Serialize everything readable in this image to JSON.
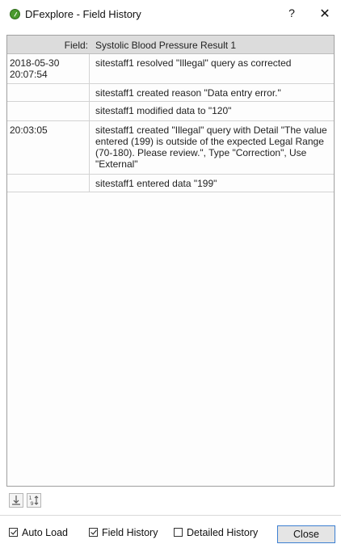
{
  "window": {
    "title": "DFexplore - Field History",
    "help_label": "?",
    "close_label": "✕",
    "app_icon": "dfexplore-logo-icon"
  },
  "history": {
    "field_label": "Field:",
    "field_value": "Systolic Blood Pressure Result 1",
    "rows": [
      {
        "time": "2018-05-30\n20:07:54",
        "desc": "sitestaff1 resolved \"Illegal\" query as corrected"
      },
      {
        "time": "",
        "desc": "sitestaff1 created reason \"Data entry error.\""
      },
      {
        "time": "",
        "desc": "sitestaff1 modified data to \"120\""
      },
      {
        "time": "20:03:05",
        "desc": "sitestaff1 created \"Illegal\" query with Detail \"The value entered (199) is outside of the expected Legal Range (70-180). Please review.\", Type \"Correction\", Use \"External\""
      },
      {
        "time": "",
        "desc": "sitestaff1 entered data \"199\""
      }
    ]
  },
  "toolbar": {
    "sort_down_icon": "sort-down-icon",
    "sort_numeric_icon": "sort-numeric-icon"
  },
  "footer": {
    "auto_load": {
      "label": "Auto Load",
      "checked": true
    },
    "field_history": {
      "label": "Field History",
      "checked": true
    },
    "detailed_history": {
      "label": "Detailed History",
      "checked": false
    },
    "close_button": "Close"
  }
}
